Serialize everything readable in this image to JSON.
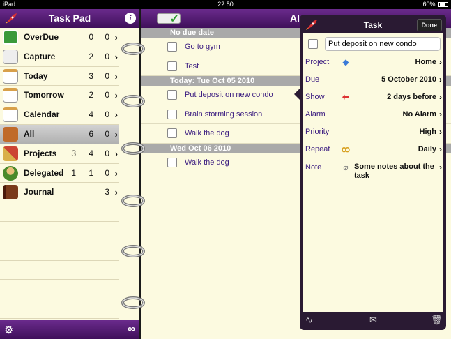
{
  "status_bar": {
    "carrier": "iPad",
    "time": "22:50",
    "battery": "60%"
  },
  "left_pane": {
    "title": "Task Pad",
    "items": [
      {
        "label": "OverDue",
        "c1": "",
        "c2": "0",
        "c3": "0",
        "color": "#3a9a3a"
      },
      {
        "label": "Capture",
        "c1": "",
        "c2": "2",
        "c3": "0",
        "color": "#e9e9e9"
      },
      {
        "label": "Today",
        "c1": "",
        "c2": "3",
        "c3": "0",
        "color": "#f3f3f3"
      },
      {
        "label": "Tomorrow",
        "c1": "",
        "c2": "2",
        "c3": "0",
        "color": "#f3f3f3"
      },
      {
        "label": "Calendar",
        "c1": "",
        "c2": "4",
        "c3": "0",
        "color": "#f3f3f3"
      },
      {
        "label": "All",
        "c1": "",
        "c2": "6",
        "c3": "0",
        "color": "#c06a2a"
      },
      {
        "label": "Projects",
        "c1": "3",
        "c2": "4",
        "c3": "0",
        "color": "#d9b04a"
      },
      {
        "label": "Delegated",
        "c1": "1",
        "c2": "1",
        "c3": "0",
        "color": "#8a6a2a"
      },
      {
        "label": "Journal",
        "c1": "",
        "c2": "",
        "c3": "3",
        "color": "#7a3a1a"
      }
    ]
  },
  "middle_pane": {
    "title": "Al",
    "sections": [
      {
        "header": "No due date",
        "tasks": [
          "Go to gym",
          "Test"
        ]
      },
      {
        "header": "Today: Tue Oct 05 2010",
        "tasks": [
          "Put deposit on new condo",
          "Brain storming session",
          "Walk the dog"
        ]
      },
      {
        "header": "Wed Oct 06 2010",
        "tasks": [
          "Walk the dog"
        ]
      }
    ]
  },
  "detail": {
    "title": "Task",
    "done_label": "Done",
    "task_name": "Put deposit on new condo",
    "fields": {
      "project": {
        "label": "Project",
        "value": "Home"
      },
      "due": {
        "label": "Due",
        "value": "5 October 2010"
      },
      "show": {
        "label": "Show",
        "value": "2 days before"
      },
      "alarm": {
        "label": "Alarm",
        "value": "No Alarm"
      },
      "priority": {
        "label": "Priority",
        "value": "High"
      },
      "repeat": {
        "label": "Repeat",
        "value": "Daily"
      },
      "note": {
        "label": "Note",
        "value": "Some notes about the task"
      }
    }
  },
  "colors": {
    "accent": "#4a1768",
    "paper": "#fcfae0",
    "link_text": "#3b1c80"
  }
}
